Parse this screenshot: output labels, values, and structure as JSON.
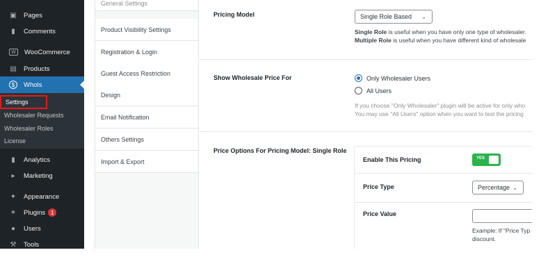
{
  "sidebar": {
    "items": [
      {
        "label": "Pages",
        "icon": "pages-icon"
      },
      {
        "label": "Comments",
        "icon": "comments-icon"
      },
      {
        "label": "WooCommerce",
        "icon": "woocommerce-icon"
      },
      {
        "label": "Products",
        "icon": "products-icon"
      },
      {
        "label": "Whols",
        "icon": "dollar-icon"
      },
      {
        "label": "Analytics",
        "icon": "analytics-icon"
      },
      {
        "label": "Marketing",
        "icon": "megaphone-icon"
      },
      {
        "label": "Appearance",
        "icon": "brush-icon"
      },
      {
        "label": "Plugins",
        "icon": "plug-icon",
        "badge": "1"
      },
      {
        "label": "Users",
        "icon": "user-icon"
      },
      {
        "label": "Tools",
        "icon": "wrench-icon"
      }
    ],
    "submenu": [
      "Settings",
      "Wholesaler Requests",
      "Wholesaler Roles",
      "License"
    ],
    "active_color": "#2271b1",
    "highlight_color": "#e01b1b"
  },
  "tabs": [
    "General Settings",
    "Product Visibility Settings",
    "Registration & Login",
    "Guest Access Restriction",
    "Design",
    "Email Notification",
    "Others Settings",
    "Import & Export"
  ],
  "pricing_model": {
    "label": "Pricing Model",
    "selected": "Single Role Based",
    "help1_bold": "Single Role",
    "help1_text": " is useful when you have only one type of wholesaler.",
    "help2_bold": "Multiple Role",
    "help2_text": " is useful when you have different kind of wholesale"
  },
  "show_price_for": {
    "label": "Show Wholesale Price For",
    "options": [
      "Only Wholesaler Users",
      "All Users"
    ],
    "selected": "Only Wholesaler Users",
    "help1": "If you choose \"Only Wholesaler\" plugin will be active for only who",
    "help2": "You may use \"All Users\" option when you want to test the pricing"
  },
  "price_options": {
    "label": "Price Options For Pricing Model: Single Role",
    "enable_label": "Enable This Pricing",
    "toggle_text": "YES",
    "toggle_color": "#2cb24b",
    "price_type_label": "Price Type",
    "price_type_selected": "Percentage",
    "price_value_label": "Price Value",
    "price_value": "",
    "price_value_help1": "Example: If \"Price Typ",
    "price_value_help2": "discount."
  }
}
